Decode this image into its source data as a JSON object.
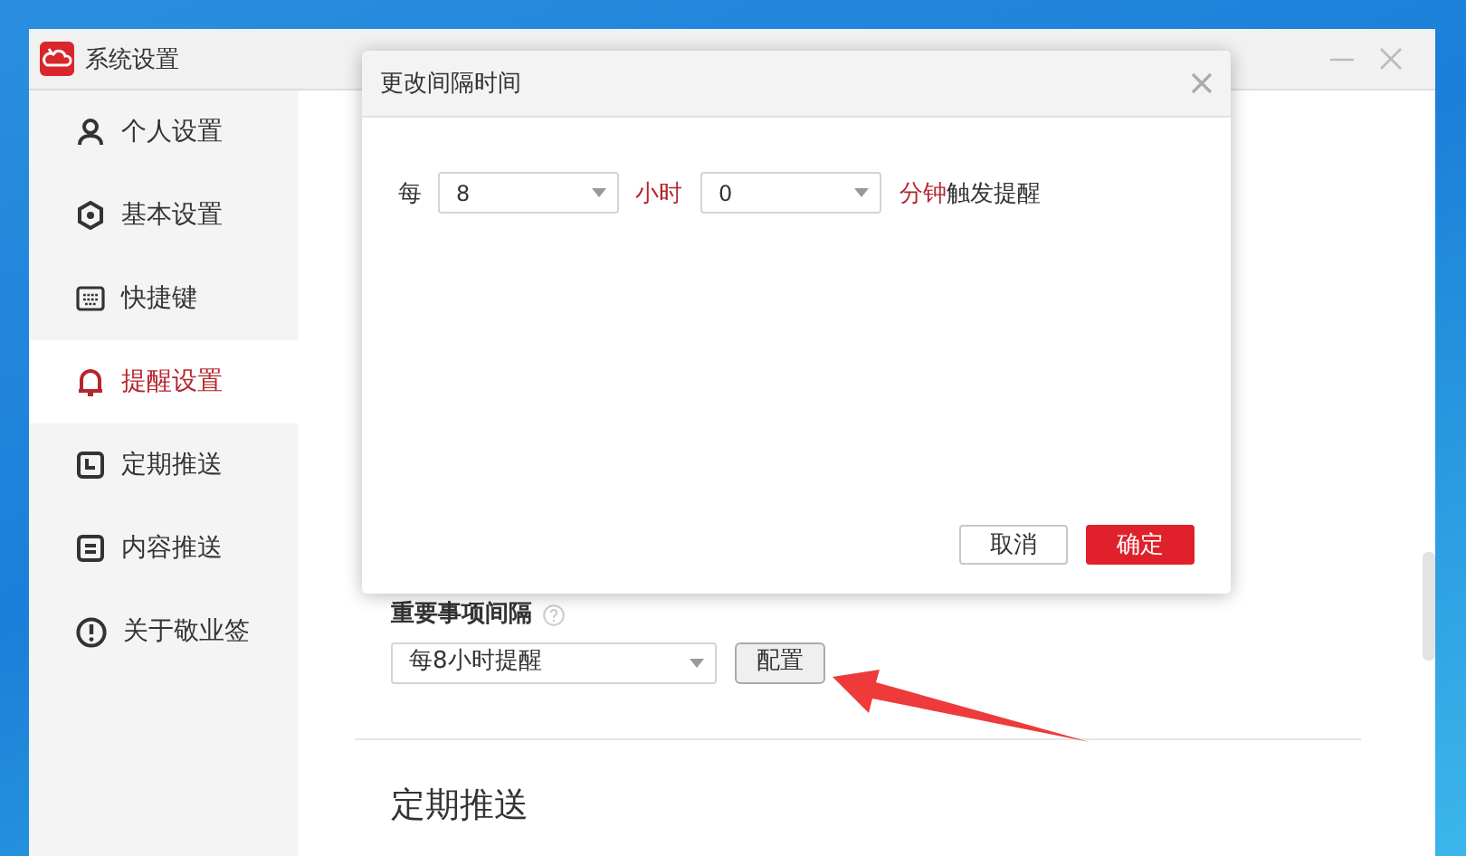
{
  "window": {
    "title": "系统设置"
  },
  "sidebar": {
    "items": [
      {
        "label": "个人设置",
        "kind": "person",
        "selected": false
      },
      {
        "label": "基本设置",
        "kind": "gear",
        "selected": false
      },
      {
        "label": "快捷键",
        "kind": "keyboard",
        "selected": false
      },
      {
        "label": "提醒设置",
        "kind": "bell",
        "selected": true
      },
      {
        "label": "定期推送",
        "kind": "clock",
        "selected": false
      },
      {
        "label": "内容推送",
        "kind": "document",
        "selected": false
      },
      {
        "label": "关于敬业签",
        "kind": "info",
        "selected": false
      }
    ]
  },
  "content": {
    "important_interval": {
      "label": "重要事项间隔",
      "value": "每8小时提醒",
      "button": "配置"
    },
    "section_heading": "定期推送"
  },
  "dialog": {
    "title": "更改间隔时间",
    "prefix": "每",
    "hours": {
      "value": "8"
    },
    "hours_unit": "小时",
    "minutes": {
      "value": "0"
    },
    "minutes_unit": "分钟",
    "suffix": "触发提醒",
    "buttons": [
      {
        "label": "取消",
        "kind": "secondary"
      },
      {
        "label": "确定",
        "kind": "primary"
      }
    ]
  }
}
